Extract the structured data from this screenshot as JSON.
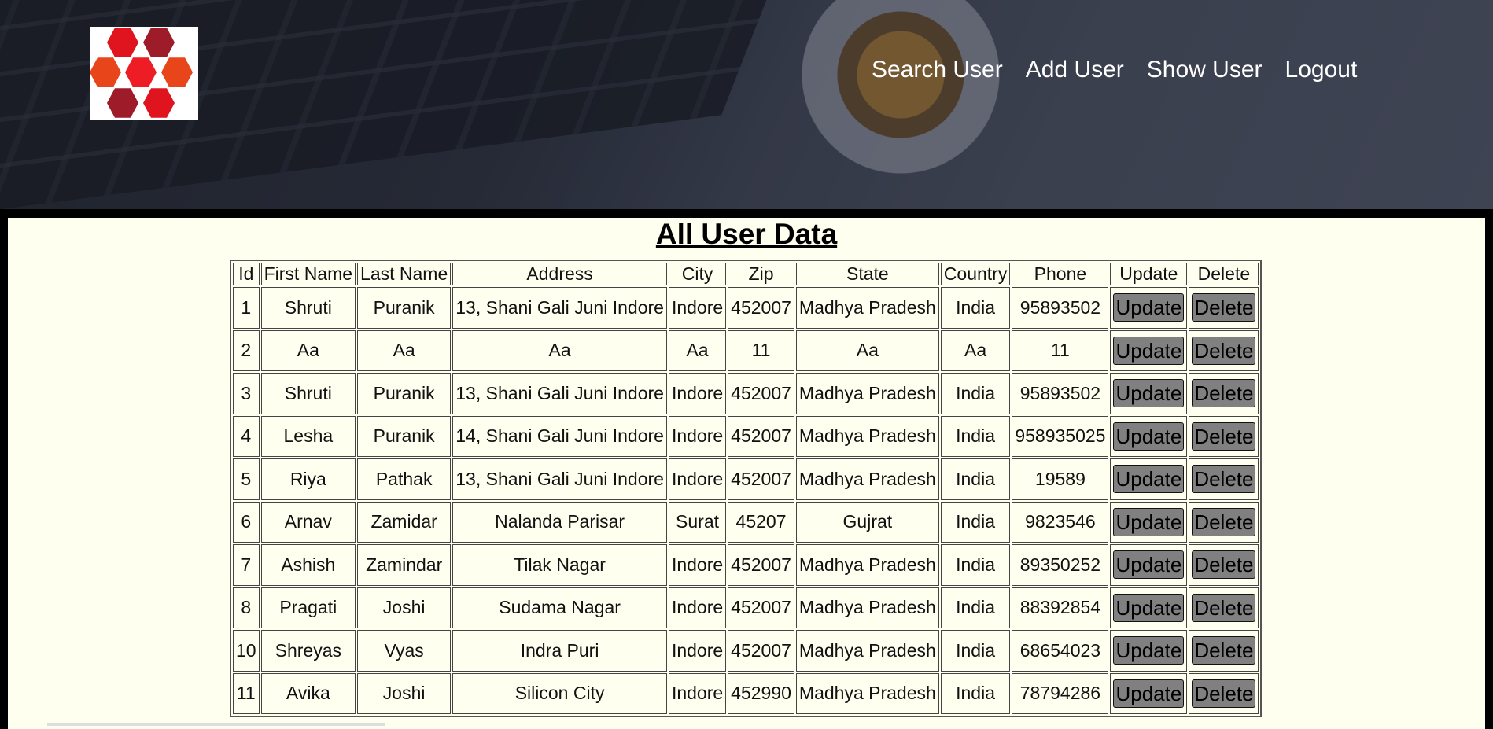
{
  "nav": {
    "items": [
      "Search User",
      "Add User",
      "Show User",
      "Logout"
    ]
  },
  "page": {
    "title": "All User Data"
  },
  "table": {
    "headers": [
      "Id",
      "First Name",
      "Last Name",
      "Address",
      "City",
      "Zip",
      "State",
      "Country",
      "Phone",
      "Update",
      "Delete"
    ],
    "rows": [
      [
        "1",
        "Shruti",
        "Puranik",
        "13, Shani Gali Juni Indore",
        "Indore",
        "452007",
        "Madhya Pradesh",
        "India",
        "95893502"
      ],
      [
        "2",
        "Aa",
        "Aa",
        "Aa",
        "Aa",
        "11",
        "Aa",
        "Aa",
        "11"
      ],
      [
        "3",
        "Shruti",
        "Puranik",
        "13, Shani Gali Juni Indore",
        "Indore",
        "452007",
        "Madhya Pradesh",
        "India",
        "95893502"
      ],
      [
        "4",
        "Lesha",
        "Puranik",
        "14, Shani Gali Juni Indore",
        "Indore",
        "452007",
        "Madhya Pradesh",
        "India",
        "958935025"
      ],
      [
        "5",
        "Riya",
        "Pathak",
        "13, Shani Gali Juni Indore",
        "Indore",
        "452007",
        "Madhya Pradesh",
        "India",
        "19589"
      ],
      [
        "6",
        "Arnav",
        "Zamidar",
        "Nalanda Parisar",
        "Surat",
        "45207",
        "Gujrat",
        "India",
        "9823546"
      ],
      [
        "7",
        "Ashish",
        "Zamindar",
        "Tilak Nagar",
        "Indore",
        "452007",
        "Madhya Pradesh",
        "India",
        "89350252"
      ],
      [
        "8",
        "Pragati",
        "Joshi",
        "Sudama Nagar",
        "Indore",
        "452007",
        "Madhya Pradesh",
        "India",
        "88392854"
      ],
      [
        "10",
        "Shreyas",
        "Vyas",
        "Indra Puri",
        "Indore",
        "452007",
        "Madhya Pradesh",
        "India",
        "68654023"
      ],
      [
        "11",
        "Avika",
        "Joshi",
        "Silicon City",
        "Indore",
        "452990",
        "Madhya Pradesh",
        "India",
        "78794286"
      ]
    ],
    "update_label": "Update",
    "delete_label": "Delete"
  },
  "colors": {
    "content_bg": "#fffff0",
    "button_bg": "#808080",
    "logo_reds": [
      "#e0141e",
      "#9e1c2a",
      "#e8461a",
      "#c8102e"
    ]
  }
}
